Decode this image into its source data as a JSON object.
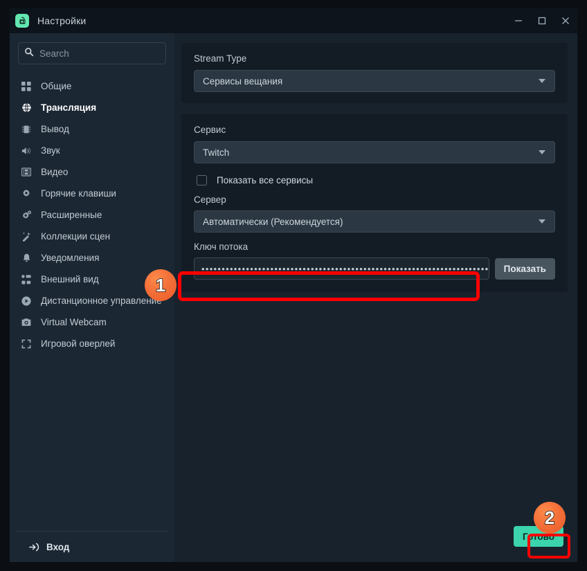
{
  "window": {
    "title": "Настройки",
    "app_icon": "camera-app-icon",
    "controls": {
      "minimize": "minimize-icon",
      "maximize": "maximize-icon",
      "close": "close-icon"
    }
  },
  "sidebar": {
    "search": {
      "placeholder": "Search",
      "value": "",
      "icon": "search-icon"
    },
    "items": [
      {
        "label": "Общие",
        "icon": "grid-icon",
        "active": false
      },
      {
        "label": "Трансляция",
        "icon": "globe-icon",
        "active": true
      },
      {
        "label": "Вывод",
        "icon": "chip-icon",
        "active": false
      },
      {
        "label": "Звук",
        "icon": "speaker-icon",
        "active": false
      },
      {
        "label": "Видео",
        "icon": "film-icon",
        "active": false
      },
      {
        "label": "Горячие клавиши",
        "icon": "gear-icon",
        "active": false
      },
      {
        "label": "Расширенные",
        "icon": "gears-icon",
        "active": false
      },
      {
        "label": "Коллекции сцен",
        "icon": "wand-icon",
        "active": false
      },
      {
        "label": "Уведомления",
        "icon": "bell-icon",
        "active": false
      },
      {
        "label": "Внешний вид",
        "icon": "layout-icon",
        "active": false
      },
      {
        "label": "Дистанционное управление",
        "icon": "play-circle-icon",
        "active": false
      },
      {
        "label": "Virtual Webcam",
        "icon": "camera-icon",
        "active": false
      },
      {
        "label": "Игровой оверлей",
        "icon": "expand-icon",
        "active": false
      }
    ],
    "login": {
      "label": "Вход",
      "icon": "login-icon"
    }
  },
  "main": {
    "stream_type": {
      "label": "Stream Type",
      "value": "Сервисы вещания",
      "caret": "chevron-down-icon"
    },
    "service": {
      "label": "Сервис",
      "value": "Twitch",
      "caret": "chevron-down-icon"
    },
    "show_all_services": {
      "label": "Показать все сервисы",
      "checked": false
    },
    "server": {
      "label": "Сервер",
      "value": "Автоматически (Рекомендуется)",
      "caret": "chevron-down-icon"
    },
    "stream_key": {
      "label": "Ключ потока",
      "value": "••••••••••••••••••••••••••••••••••••••••••••••••••••••••••••••••••••••••••••••••",
      "show_button": "Показать"
    },
    "done_button": "Готово"
  },
  "annotations": {
    "badges": [
      {
        "number": "1",
        "target": "stream-key-input"
      },
      {
        "number": "2",
        "target": "done-button"
      }
    ],
    "highlight_color": "#ff0000",
    "badge_color": "#f4713a",
    "accent_color": "#3bd4ac"
  }
}
